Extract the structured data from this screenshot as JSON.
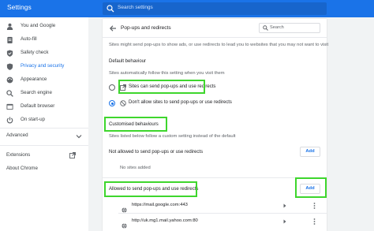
{
  "app": {
    "title": "Settings"
  },
  "search": {
    "placeholder": "Search settings",
    "icon": "search-icon"
  },
  "sidebar": {
    "items": [
      {
        "label": "You and Google",
        "icon": "person-icon"
      },
      {
        "label": "Auto-fill",
        "icon": "clipboard-icon"
      },
      {
        "label": "Safety check",
        "icon": "shield-check-icon"
      },
      {
        "label": "Privacy and security",
        "icon": "shield-icon",
        "active": true
      },
      {
        "label": "Appearance",
        "icon": "palette-icon"
      },
      {
        "label": "Search engine",
        "icon": "search-icon"
      },
      {
        "label": "Default browser",
        "icon": "browser-icon"
      },
      {
        "label": "On start-up",
        "icon": "power-icon"
      }
    ],
    "advanced": "Advanced",
    "extensions": "Extensions",
    "about": "About Chrome"
  },
  "page": {
    "title": "Pop-ups and redirects",
    "search_placeholder": "Search",
    "intro": "Sites might send pop-ups to show ads, or use redirects to lead you to websites that you may not want to visit",
    "default_heading": "Default behaviour",
    "default_desc": "Sites automatically follow this setting when you visit them",
    "option_allow": "Sites can send pop-ups and use redirects",
    "option_block": "Don't allow sites to send pop-ups or use redirects",
    "custom_heading": "Customised behaviours",
    "custom_desc": "Sites listed below follow a custom setting instead of the default",
    "not_allowed_label": "Not allowed to send pop-ups or use redirects",
    "add_label": "Add",
    "no_sites": "No sites added",
    "allowed_label": "Allowed to send pop-ups and use redirects",
    "sites": [
      "https://mail.google.com:443",
      "http://uk.mg1.mail.yahoo.com:80"
    ]
  },
  "colors": {
    "accent": "#1a73e8",
    "highlight": "#3ed62d"
  }
}
